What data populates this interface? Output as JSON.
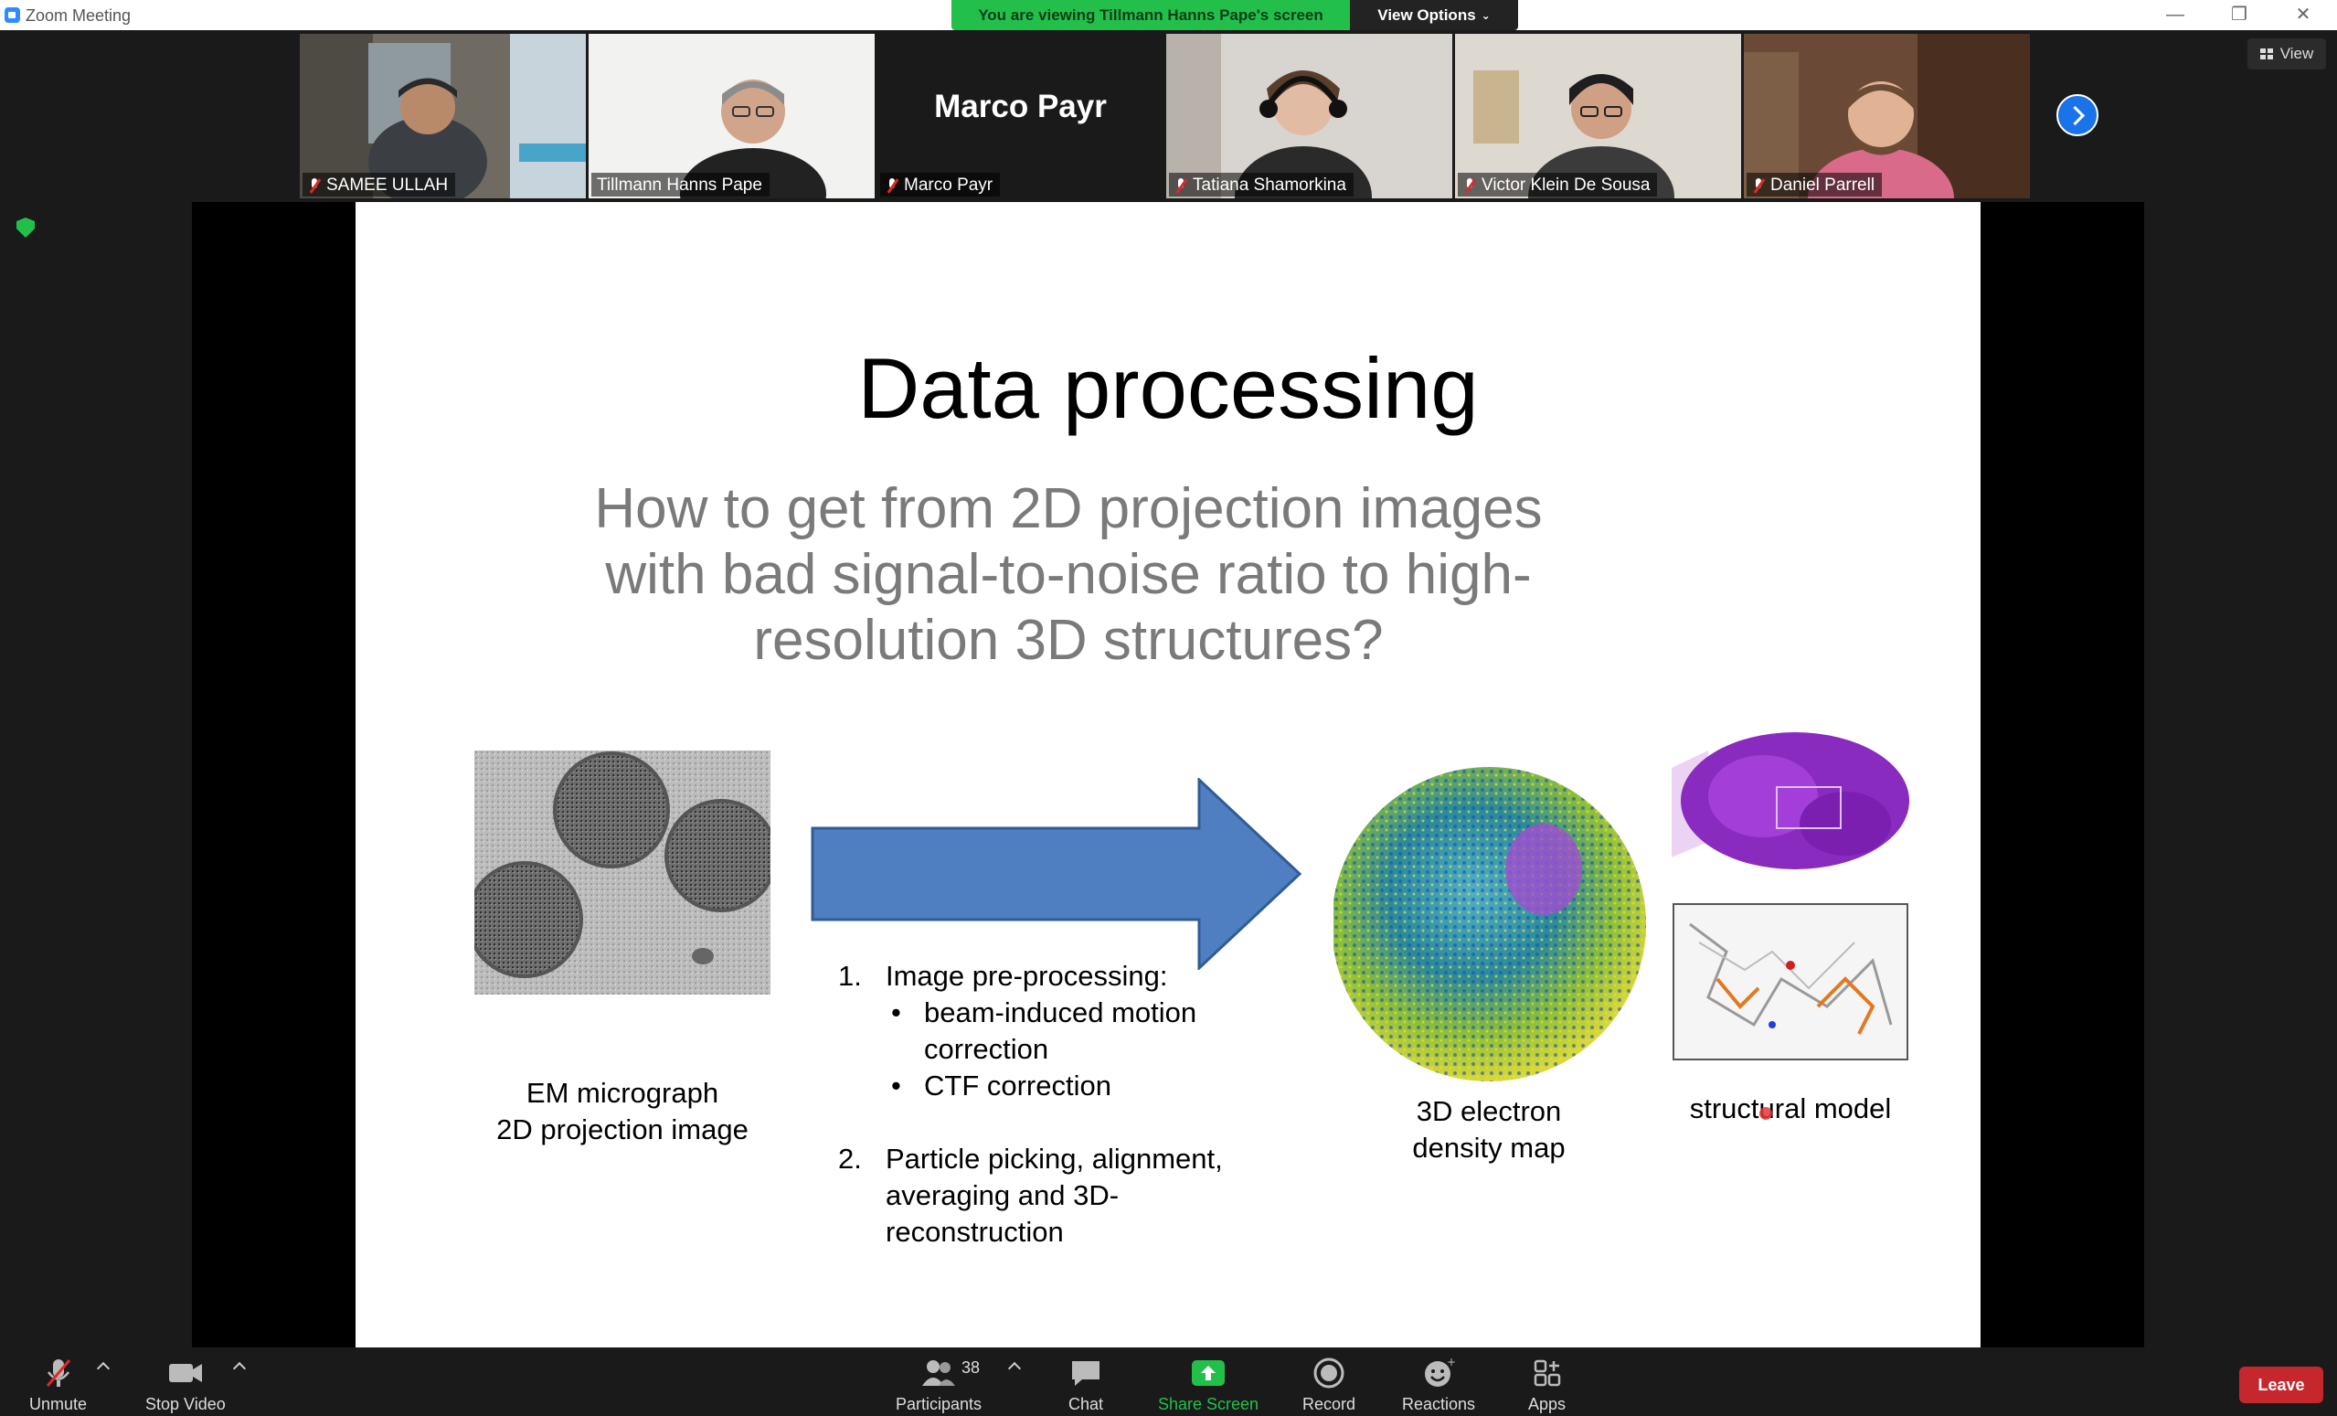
{
  "window": {
    "title": "Zoom Meeting"
  },
  "share_banner": {
    "message": "You are viewing Tillmann Hanns Pape's screen",
    "options_label": "View Options"
  },
  "view_button": {
    "label": "View"
  },
  "participants_strip": [
    {
      "name": "SAMEE ULLAH",
      "muted": true
    },
    {
      "name": "Tillmann Hanns Pape",
      "muted": false,
      "active_speaker": true
    },
    {
      "name": "Marco Payr",
      "muted": true,
      "video_off": true
    },
    {
      "name": "Tatiana Shamorkina",
      "muted": true
    },
    {
      "name": "Victor Klein De Sousa",
      "muted": true
    },
    {
      "name": "Daniel Parrell",
      "muted": true
    }
  ],
  "slide": {
    "title": "Data processing",
    "subtitle": "How to get from 2D projection images with bad signal-to-noise ratio to high-resolution 3D structures?",
    "caption_micrograph_line1": "EM micrograph",
    "caption_micrograph_line2": "2D projection image",
    "step1_num": "1.",
    "step1": "Image pre-processing:",
    "step1_bullet1_line1": "beam-induced motion",
    "step1_bullet1_line2": "correction",
    "step1_bullet2": "CTF correction",
    "step2_num": "2.",
    "step2_line1": "Particle picking, alignment,",
    "step2_line2": "averaging and 3D-",
    "step2_line3": "reconstruction",
    "caption_density_line1": "3D electron",
    "caption_density_line2": "density map",
    "caption_model": "structural model"
  },
  "toolbar": {
    "unmute": "Unmute",
    "stop_video": "Stop Video",
    "participants": "Participants",
    "participants_count": "38",
    "chat": "Chat",
    "share_screen": "Share Screen",
    "record": "Record",
    "reactions": "Reactions",
    "apps": "Apps",
    "leave": "Leave"
  },
  "colors": {
    "share_green": "#22c04a",
    "leave_red": "#c5272d",
    "accent_blue": "#1a73e8",
    "arrow_blue": "#4f7fc0"
  }
}
